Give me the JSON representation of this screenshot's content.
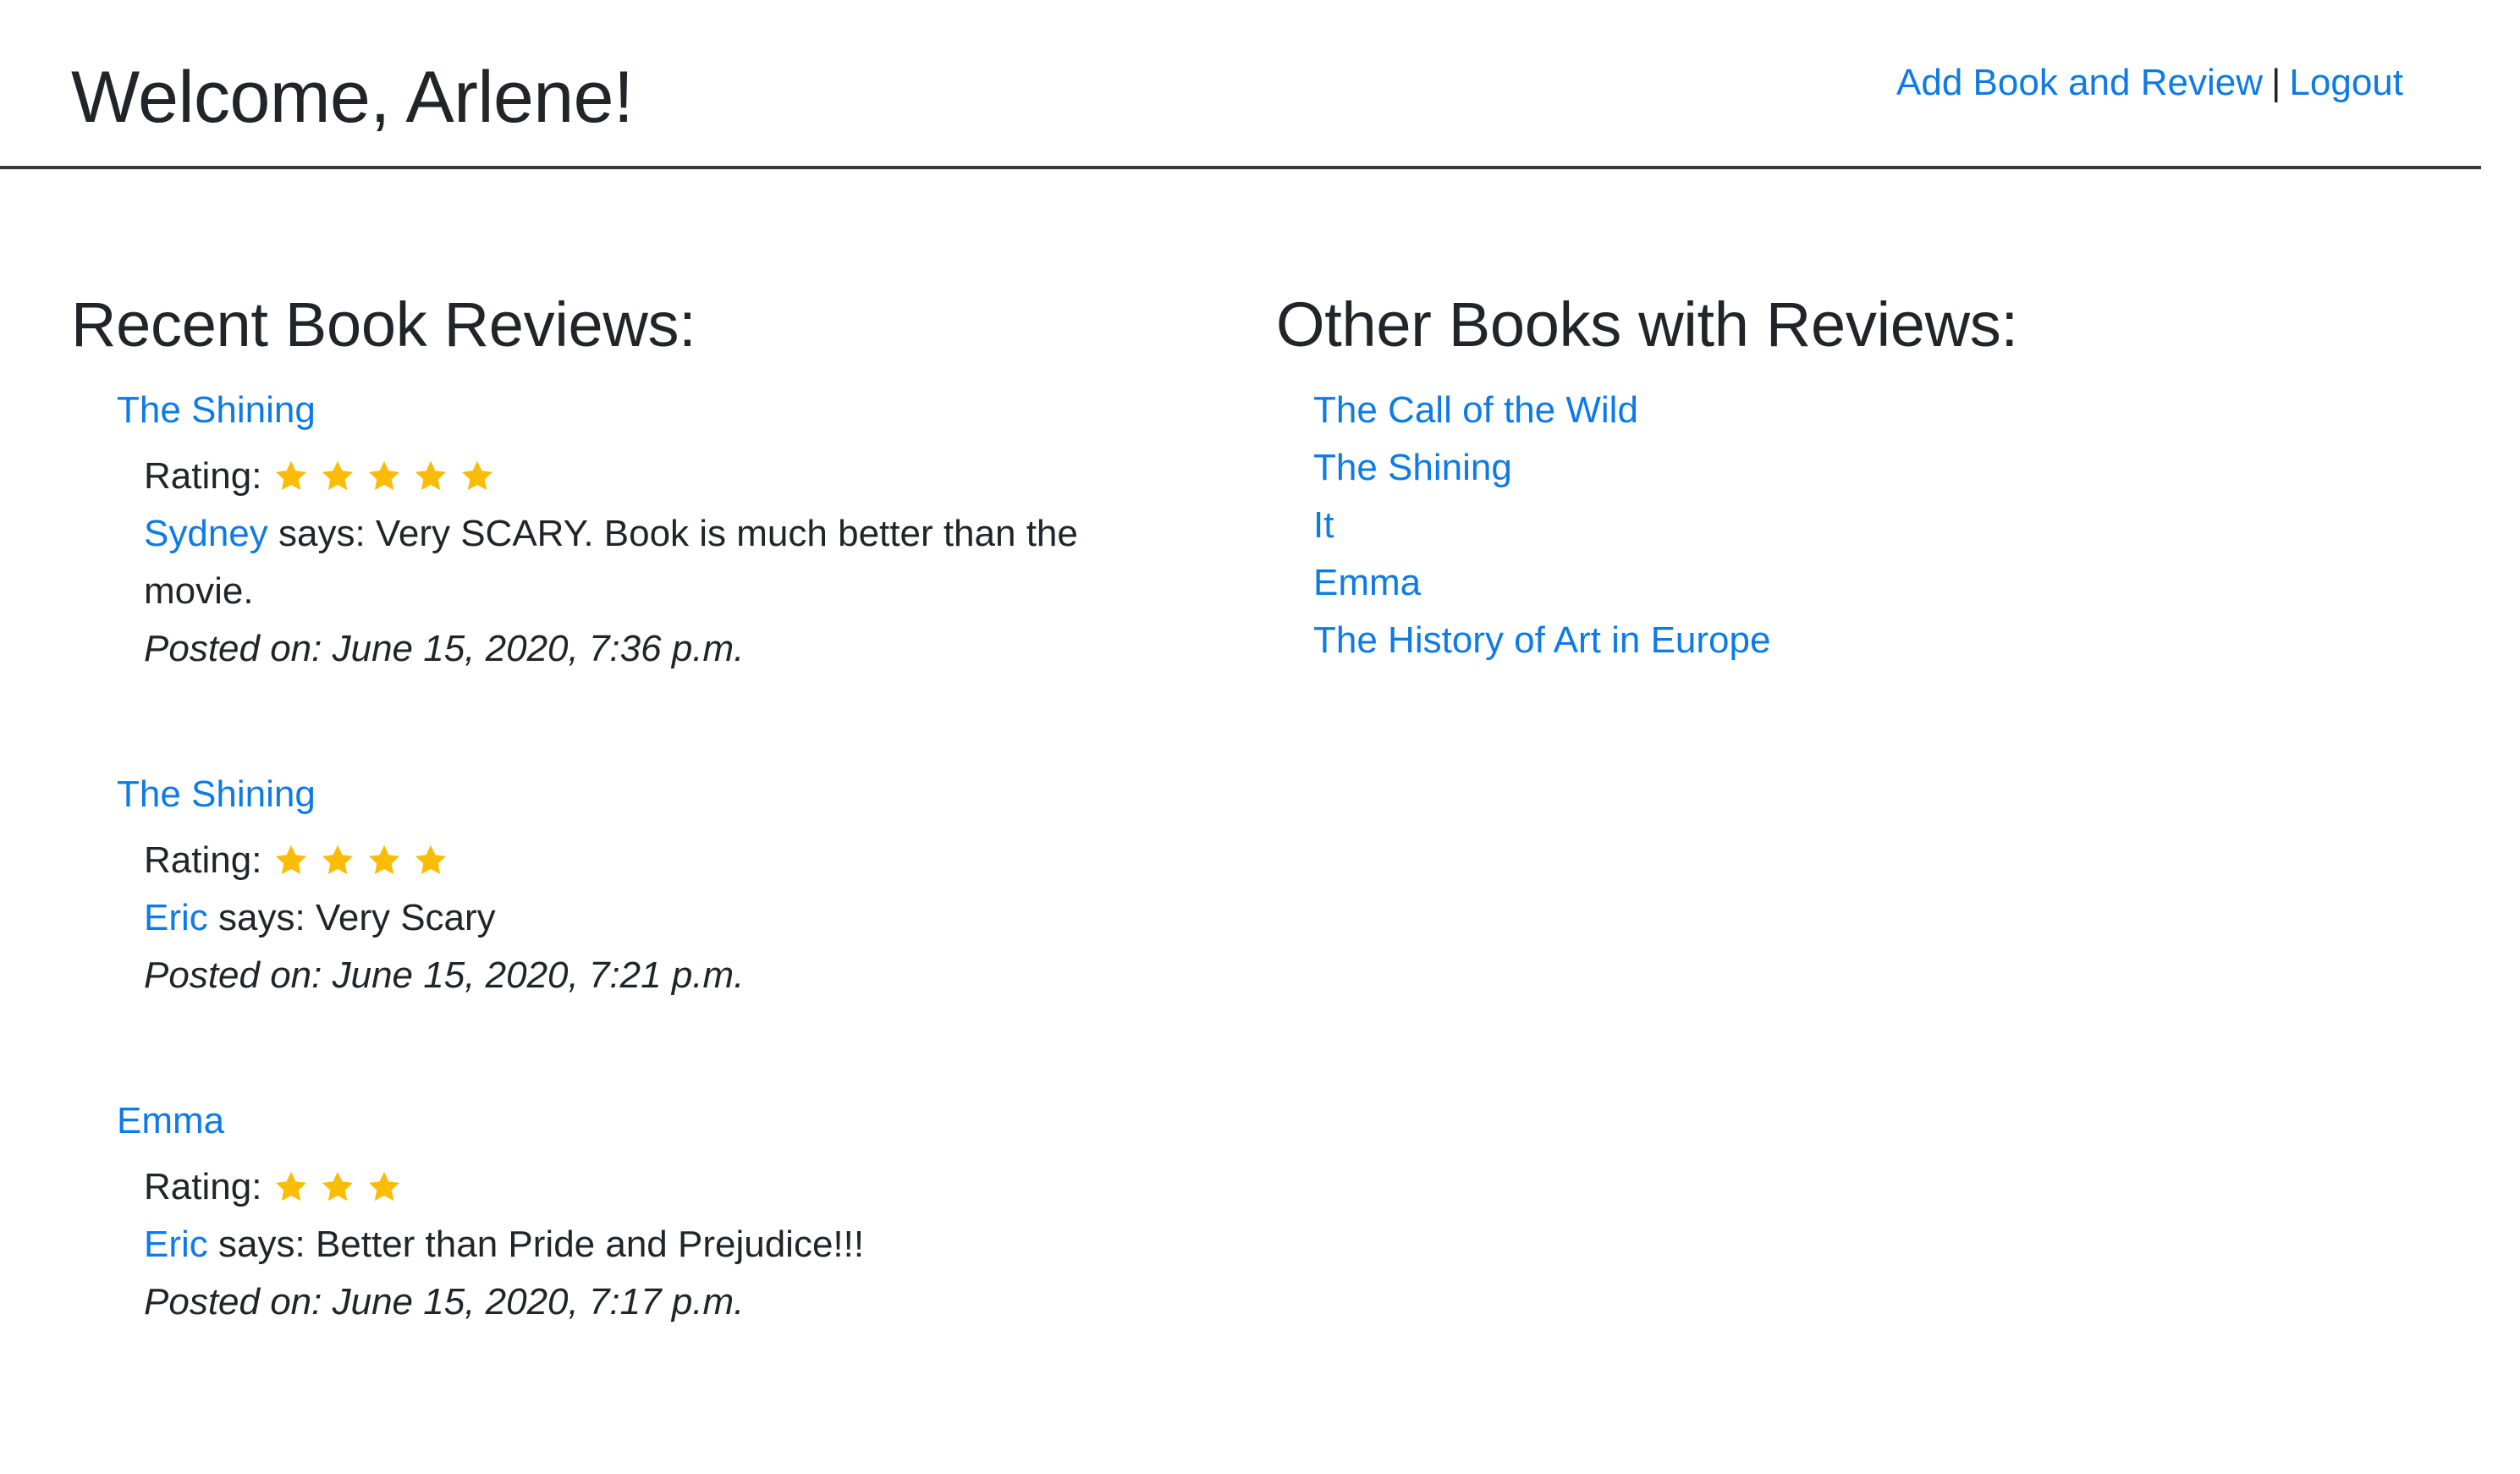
{
  "header": {
    "welcome": "Welcome, Arlene!",
    "nav": {
      "add_label": "Add Book and Review",
      "separator": "|",
      "logout_label": "Logout"
    }
  },
  "recent": {
    "title": "Recent Book Reviews:",
    "rating_label": "Rating:",
    "says_text": " says: ",
    "reviews": [
      {
        "book": "The Shining",
        "rating": 5,
        "user": "Sydney",
        "text": "Very SCARY. Book is much better than the movie.",
        "posted": "Posted on: June 15, 2020, 7:36 p.m."
      },
      {
        "book": "The Shining",
        "rating": 4,
        "user": "Eric",
        "text": "Very Scary",
        "posted": "Posted on: June 15, 2020, 7:21 p.m."
      },
      {
        "book": "Emma",
        "rating": 3,
        "user": "Eric",
        "text": "Better than Pride and Prejudice!!!",
        "posted": "Posted on: June 15, 2020, 7:17 p.m."
      }
    ]
  },
  "other": {
    "title": "Other Books with Reviews:",
    "books": [
      "The Call of the Wild",
      "The Shining",
      "It",
      "Emma",
      "The History of Art in Europe"
    ]
  },
  "colors": {
    "link": "#0d7be6",
    "star": "#fbbc05",
    "text": "#212529",
    "rule": "#343a40"
  },
  "icons": {
    "star": "star-icon"
  }
}
